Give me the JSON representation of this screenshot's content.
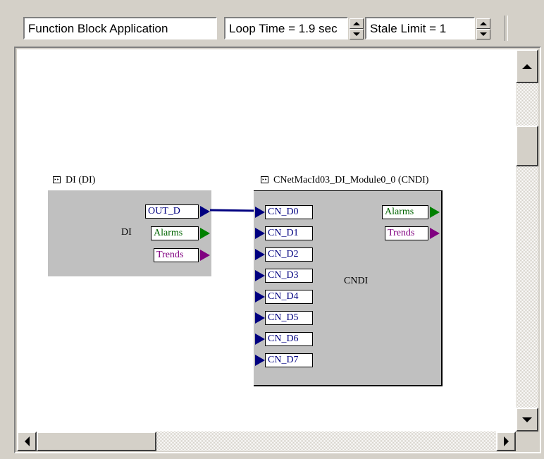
{
  "toolbar": {
    "app_field": "Function Block Application",
    "loop_time": "Loop Time = 1.9 sec",
    "stale_limit": "Stale Limit = 1"
  },
  "blocks": {
    "di": {
      "title": "DI (DI)",
      "label": "DI",
      "outputs": [
        "OUT_D",
        "Alarms",
        "Trends"
      ]
    },
    "cndi": {
      "title": "CNetMacId03_DI_Module0_0 (CNDI)",
      "label": "CNDI",
      "inputs": [
        "CN_D0",
        "CN_D1",
        "CN_D2",
        "CN_D3",
        "CN_D4",
        "CN_D5",
        "CN_D6",
        "CN_D7"
      ],
      "outputs": [
        "Alarms",
        "Trends"
      ]
    }
  },
  "colors": {
    "blue_port": "#000080",
    "green_port": "#008000",
    "purple_port": "#800080",
    "connection": "#000080"
  },
  "icons": {
    "block_icon": "block-menu-icon",
    "scroll_up": "arrow-up-icon",
    "scroll_down": "arrow-down-icon",
    "scroll_left": "arrow-left-icon",
    "scroll_right": "arrow-right-icon"
  }
}
